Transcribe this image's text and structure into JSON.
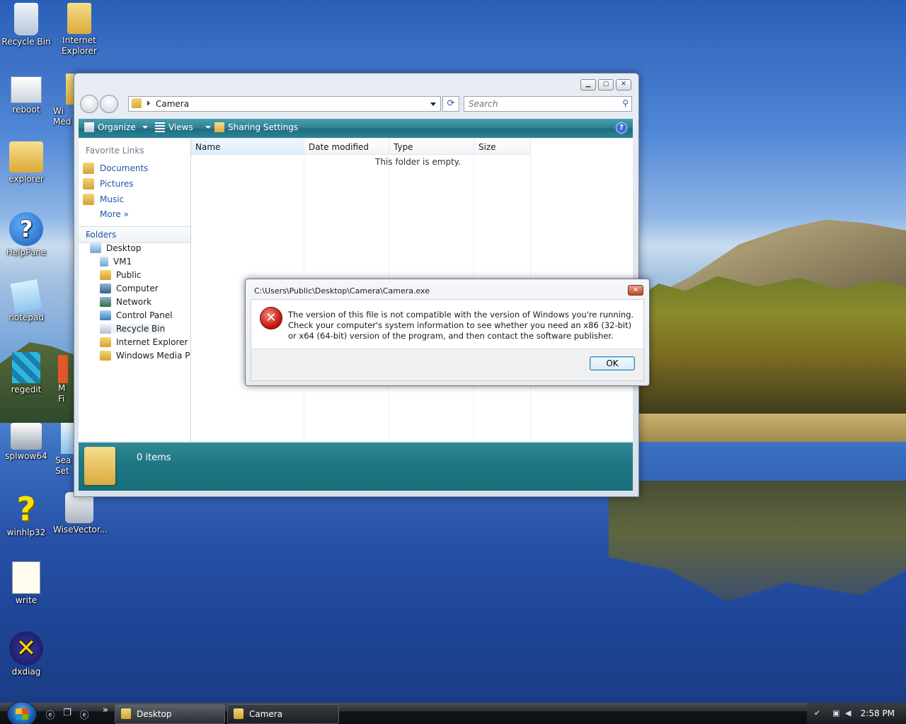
{
  "desktop": {
    "icons": [
      {
        "label": "Recycle Bin",
        "icon": "recycle-bin-icon"
      },
      {
        "label": "Internet Explorer",
        "icon": "internet-explorer-icon"
      },
      {
        "label": "reboot",
        "icon": "reboot-icon"
      },
      {
        "label": "Wi Med",
        "icon": "windows-media-icon"
      },
      {
        "label": "explorer",
        "icon": "folder-icon"
      },
      {
        "label": "HelpPane",
        "icon": "help-icon"
      },
      {
        "label": "notepad",
        "icon": "notepad-icon"
      },
      {
        "label": "regedit",
        "icon": "regedit-icon"
      },
      {
        "label": "M Fi",
        "icon": "media-icon"
      },
      {
        "label": "splwow64",
        "icon": "printer-icon"
      },
      {
        "label": "Sea Set",
        "icon": "setup-icon"
      },
      {
        "label": "winhlp32",
        "icon": "help-question-icon"
      },
      {
        "label": "WiseVector...",
        "icon": "shield-icon"
      },
      {
        "label": "write",
        "icon": "write-icon"
      },
      {
        "label": "dxdiag",
        "icon": "dxdiag-icon"
      }
    ]
  },
  "explorer": {
    "address": "Camera",
    "search_placeholder": "Search",
    "toolbar": {
      "organize": "Organize",
      "views": "Views",
      "sharing": "Sharing Settings"
    },
    "favorite_links_title": "Favorite Links",
    "favorites": [
      "Documents",
      "Pictures",
      "Music"
    ],
    "more": "More",
    "folders_title": "Folders",
    "tree": [
      "Desktop",
      "VM1",
      "Public",
      "Computer",
      "Network",
      "Control Panel",
      "Recycle Bin",
      "Internet Explorer",
      "Windows Media Pla"
    ],
    "columns": [
      "Name",
      "Date modified",
      "Type",
      "Size"
    ],
    "empty_text": "This folder is empty.",
    "item_count": "0 items"
  },
  "dialog": {
    "title": "C:\\Users\\Public\\Desktop\\Camera\\Camera.exe",
    "message": "The version of this file is not compatible with the version of Windows you're running. Check your computer's system information to see whether you need an x86 (32-bit) or x64 (64-bit) version of the program, and then contact the software publisher.",
    "ok_label": "OK"
  },
  "taskbar": {
    "buttons": [
      "Desktop",
      "Camera"
    ],
    "more": "»",
    "clock": "2:58 PM"
  }
}
